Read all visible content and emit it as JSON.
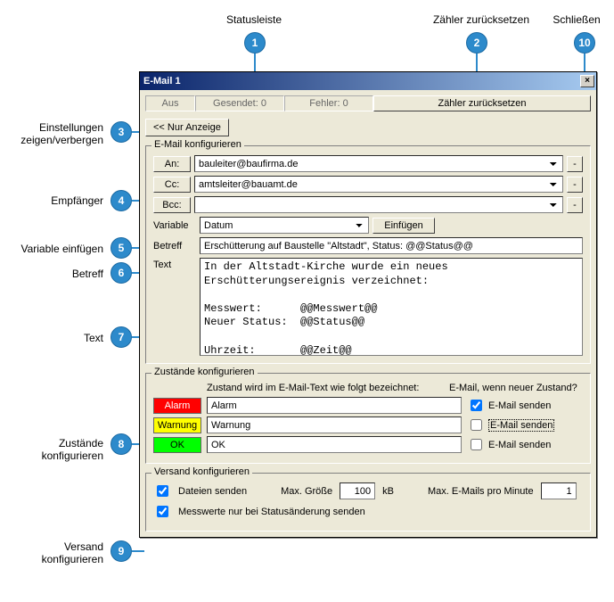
{
  "annotations": {
    "a1": "Statusleiste",
    "a2": "Zähler zurücksetzen",
    "a3_1": "Einstellungen",
    "a3_2": "zeigen/verbergen",
    "a4": "Empfänger",
    "a5": "Variable einfügen",
    "a6": "Betreff",
    "a7": "Text",
    "a8_1": "Zustände",
    "a8_2": "konfigurieren",
    "a9_1": "Versand",
    "a9_2": "konfigurieren",
    "a10": "Schließen",
    "n1": "1",
    "n2": "2",
    "n3": "3",
    "n4": "4",
    "n5": "5",
    "n6": "6",
    "n7": "7",
    "n8": "8",
    "n9": "9",
    "n10": "10"
  },
  "titlebar": {
    "title": "E-Mail 1"
  },
  "status": {
    "aus": "Aus",
    "sent": "Gesendet: 0",
    "errors": "Fehler: 0",
    "reset": "Zähler zurücksetzen"
  },
  "toggle": "<< Nur Anzeige",
  "config": {
    "legend": "E-Mail konfigurieren",
    "an_label": "An:",
    "an_value": "bauleiter@baufirma.de",
    "cc_label": "Cc:",
    "cc_value": "amtsleiter@bauamt.de",
    "bcc_label": "Bcc:",
    "bcc_value": "",
    "var_label": "Variable",
    "var_value": "Datum",
    "insert": "Einfügen",
    "subj_label": "Betreff",
    "subj_value": "Erschütterung auf Baustelle \"Altstadt\", Status: @@Status@@",
    "text_label": "Text",
    "text_value": "In der Altstadt-Kirche wurde ein neues\nErschütterungsereignis verzeichnet:\n\nMesswert:      @@Messwert@@\nNeuer Status:  @@Status@@\n\nUhrzeit:       @@Zeit@@\nDatum:         @@Datum@@",
    "minus": "-"
  },
  "states": {
    "legend": "Zustände konfigurieren",
    "header_left": "Zustand wird im E-Mail-Text wie folgt bezeichnet:",
    "header_right": "E-Mail, wenn neuer Zustand?",
    "alarm_lbl": "Alarm",
    "alarm_val": "Alarm",
    "warn_lbl": "Warnung",
    "warn_val": "Warnung",
    "ok_lbl": "OK",
    "ok_val": "OK",
    "send": "E-Mail senden"
  },
  "versand": {
    "legend": "Versand konfigurieren",
    "send_files": "Dateien senden",
    "max_size_lbl": "Max. Größe",
    "max_size_val": "100",
    "kb": "kB",
    "max_per_min_lbl": "Max. E-Mails pro Minute",
    "max_per_min_val": "1",
    "only_on_change": "Messwerte nur bei Statusänderung senden"
  }
}
